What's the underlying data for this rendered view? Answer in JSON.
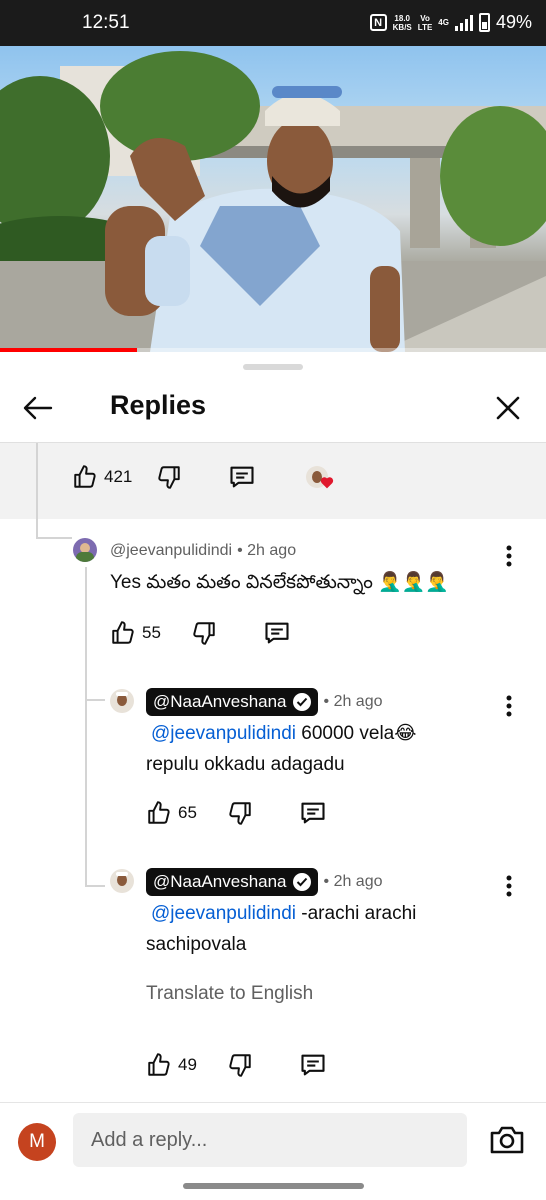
{
  "status_bar": {
    "time": "12:51",
    "net_speed_value": "18.0",
    "net_speed_unit": "KB/S",
    "volte_top": "Vo",
    "volte_bottom": "LTE",
    "network": "4G",
    "battery": "49%"
  },
  "video": {
    "progress_fraction": 0.25,
    "progress_color": "#ff0000"
  },
  "sheet": {
    "title": "Replies",
    "back_icon": "arrow-left-icon",
    "close_icon": "close-icon"
  },
  "parent_comment": {
    "likes": "421",
    "creator_heart": "heart-icon"
  },
  "replies": [
    {
      "author": "@jeevanpulidindi",
      "time": "• 2h ago",
      "text": "Yes మతం మతం వినలేకపోతున్నాం 🤦‍♂️🤦‍♂️🤦‍♂️",
      "likes": "55"
    },
    {
      "author": "@NaaAnveshana",
      "time": "• 2h ago",
      "mention": "@jeevanpulidindi",
      "text": " 60000 vela😂 repulu okkadu adagadu",
      "likes": "65"
    },
    {
      "author": "@NaaAnveshana",
      "time": "• 2h ago",
      "mention": "@jeevanpulidindi",
      "text": " -arachi arachi sachipovala",
      "translate": "Translate to English",
      "likes": "49"
    }
  ],
  "reply_bar": {
    "avatar_letter": "M",
    "placeholder": "Add a reply..."
  },
  "colors": {
    "accent": "#065fd4",
    "chip_bg": "#0f0f0f",
    "avatar_bg": "#c5431f"
  }
}
